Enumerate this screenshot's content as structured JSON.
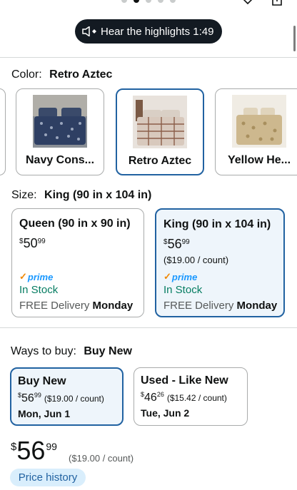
{
  "audio": {
    "label": "Hear the highlights 1:49",
    "icon": "speaker-icon"
  },
  "color": {
    "label": "Color:",
    "selected": "Retro Aztec",
    "options": [
      {
        "label": "Navy Cons...",
        "image": "navy-bedding-photo"
      },
      {
        "label": "Retro Aztec",
        "image": "retro-aztec-bedding-photo"
      },
      {
        "label": "Yellow He...",
        "image": "yellow-bedding-photo"
      }
    ]
  },
  "size": {
    "label": "Size:",
    "selected": "King (90 in x 104 in)",
    "options": [
      {
        "name": "Queen (90 in x 90 in)",
        "currency": "$",
        "price_whole": "50",
        "price_frac": "99",
        "unit_price": "",
        "prime": "prime",
        "stock": "In Stock",
        "delivery_prefix": "FREE Delivery",
        "delivery_day": "Monday"
      },
      {
        "name": "King (90 in x 104 in)",
        "currency": "$",
        "price_whole": "56",
        "price_frac": "99",
        "unit_price": "($19.00 / count)",
        "prime": "prime",
        "stock": "In Stock",
        "delivery_prefix": "FREE Delivery",
        "delivery_day": "Monday"
      }
    ]
  },
  "ways_to_buy": {
    "label": "Ways to buy:",
    "selected": "Buy New",
    "options": [
      {
        "name": "Buy New",
        "currency": "$",
        "price_whole": "56",
        "price_frac": "99",
        "unit_price": "($19.00 / count)",
        "date": "Mon, Jun 1"
      },
      {
        "name": "Used - Like New",
        "currency": "$",
        "price_whole": "46",
        "price_frac": "26",
        "unit_price": "($15.42 / count)",
        "date": "Tue, Jun 2"
      }
    ]
  },
  "price": {
    "currency": "$",
    "whole": "56",
    "frac": "99",
    "unit_price": "($19.00 / count)"
  },
  "price_history": {
    "label": "Price history"
  },
  "colors": {
    "selected_border": "#2162a1",
    "selected_bg": "#eef5fb",
    "prime_blue": "#1a98ff",
    "in_stock_green": "#067d62",
    "pill_bg": "#131a22",
    "history_bg": "#d9eefc"
  }
}
